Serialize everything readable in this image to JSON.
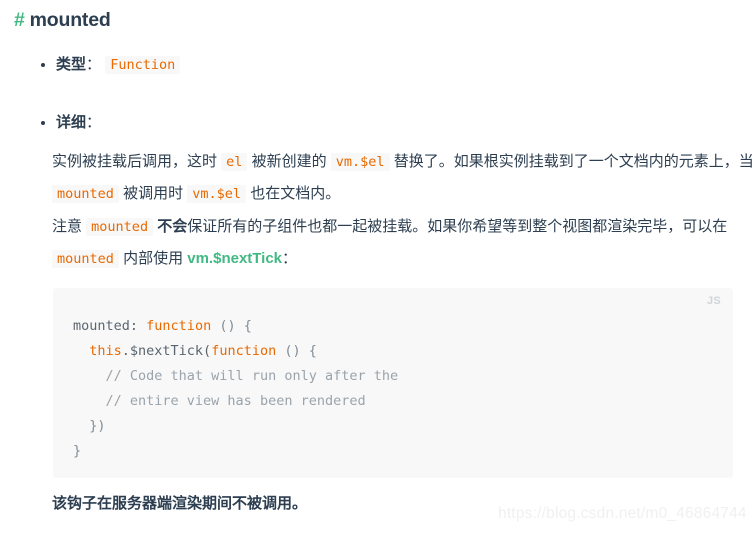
{
  "heading": {
    "hash": "#",
    "text": "mounted"
  },
  "bullets": [
    {
      "label": "类型",
      "colon": "：",
      "code": "Function"
    },
    {
      "label": "详细",
      "colon": "："
    }
  ],
  "detail_paragraph": {
    "seg1": "实例被挂载后调用，这时 ",
    "code1": "el",
    "seg2": " 被新创建的 ",
    "code2": "vm.$el",
    "seg3": " 替换了。如果根实例挂载到了一个文档内的元素上，当 ",
    "code3": "mounted",
    "seg4": " 被调用时 ",
    "code4": "vm.$el",
    "seg5": " 也在文档内。"
  },
  "note_paragraph": {
    "seg1": "注意 ",
    "code1": "mounted",
    "seg2": " ",
    "bold1": "不会",
    "seg3": "保证所有的子组件也都一起被挂载。如果你希望等到整个视图都渲染完毕，可以在 ",
    "code2": "mounted",
    "seg4": " 内部使用 ",
    "link1": "vm.$nextTick",
    "seg5": "："
  },
  "code_block": {
    "lang_label": "JS",
    "lines": [
      {
        "tokens": [
          {
            "t": "mounted:",
            "c": "plain"
          },
          {
            "t": " ",
            "c": "plain"
          },
          {
            "t": "function",
            "c": "kw"
          },
          {
            "t": " () {",
            "c": "punct"
          }
        ]
      },
      {
        "tokens": [
          {
            "t": "  ",
            "c": "plain"
          },
          {
            "t": "this",
            "c": "this"
          },
          {
            "t": ".$nextTick(",
            "c": "plain"
          },
          {
            "t": "function",
            "c": "kw"
          },
          {
            "t": " () {",
            "c": "punct"
          }
        ]
      },
      {
        "tokens": [
          {
            "t": "    ",
            "c": "plain"
          },
          {
            "t": "// Code that will run only after the",
            "c": "comment"
          }
        ]
      },
      {
        "tokens": [
          {
            "t": "    ",
            "c": "plain"
          },
          {
            "t": "// entire view has been rendered",
            "c": "comment"
          }
        ]
      },
      {
        "tokens": [
          {
            "t": "  })",
            "c": "punct"
          }
        ]
      },
      {
        "tokens": [
          {
            "t": "}",
            "c": "punct"
          }
        ]
      }
    ],
    "plain_text": "mounted: function () {\n  this.$nextTick(function () {\n    // Code that will run only after the\n    // entire view has been rendered\n  })\n}"
  },
  "footnote": "该钩子在服务器端渲染期间不被调用。",
  "watermark": "https://blog.csdn.net/m0_46864744",
  "colors": {
    "accent_green": "#42b983",
    "inline_code": "#e96900",
    "text": "#2c3e50",
    "code_bg": "#f8f8f8",
    "comment": "#9aa3ab"
  }
}
